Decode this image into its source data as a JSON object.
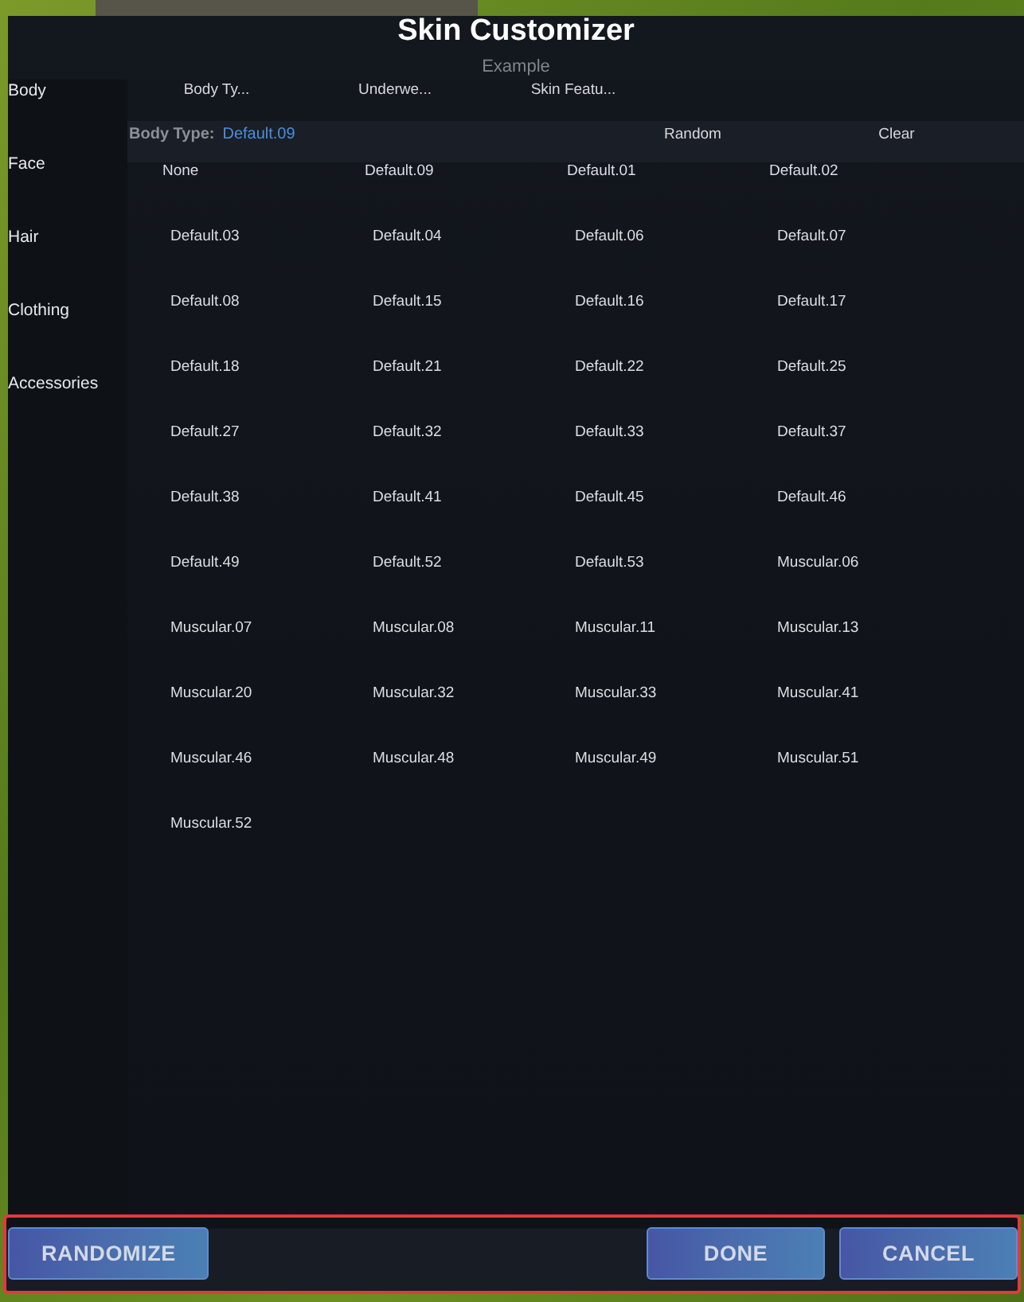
{
  "window": {
    "title": "Skin Customizer",
    "subtitle": "Example"
  },
  "sidebar": {
    "items": [
      {
        "label": "Body"
      },
      {
        "label": "Face"
      },
      {
        "label": "Hair"
      },
      {
        "label": "Clothing"
      },
      {
        "label": "Accessories"
      }
    ]
  },
  "sub_tabs": [
    {
      "label": "Body Ty..."
    },
    {
      "label": "Underwe..."
    },
    {
      "label": "Skin Featu..."
    }
  ],
  "selection_bar": {
    "label": "Body Type:",
    "value": "Default.09",
    "actions": [
      "Random",
      "Clear"
    ]
  },
  "options": [
    "None",
    "Default.09",
    "Default.01",
    "Default.02",
    "Default.03",
    "Default.04",
    "Default.06",
    "Default.07",
    "Default.08",
    "Default.15",
    "Default.16",
    "Default.17",
    "Default.18",
    "Default.21",
    "Default.22",
    "Default.25",
    "Default.27",
    "Default.32",
    "Default.33",
    "Default.37",
    "Default.38",
    "Default.41",
    "Default.45",
    "Default.46",
    "Default.49",
    "Default.52",
    "Default.53",
    "Muscular.06",
    "Muscular.07",
    "Muscular.08",
    "Muscular.11",
    "Muscular.13",
    "Muscular.20",
    "Muscular.32",
    "Muscular.33",
    "Muscular.41",
    "Muscular.46",
    "Muscular.48",
    "Muscular.49",
    "Muscular.51",
    "Muscular.52"
  ],
  "footer": {
    "left_buttons": [
      "RANDOMIZE"
    ],
    "right_buttons": [
      "DONE",
      "CANCEL"
    ]
  }
}
